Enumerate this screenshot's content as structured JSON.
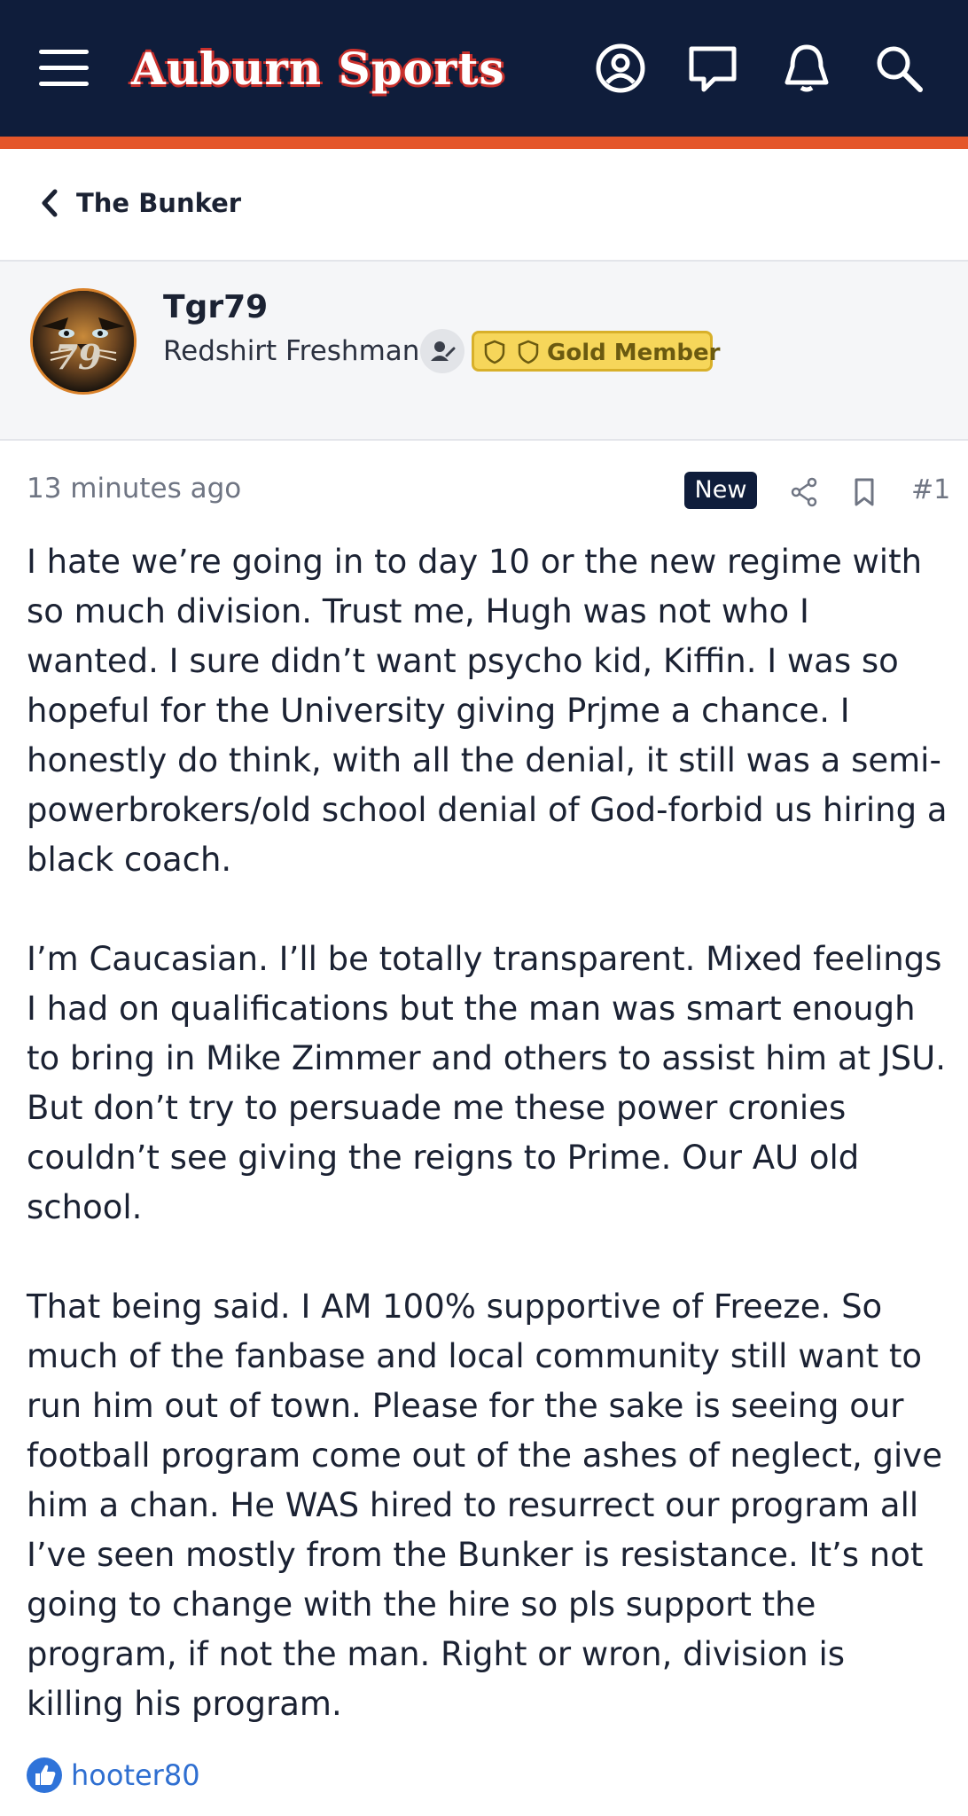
{
  "header": {
    "site_name": "Auburn Sports",
    "brand_navy": "#0f1d3b",
    "brand_orange": "#e4562a",
    "icons": [
      "menu-icon",
      "account-icon",
      "conversations-icon",
      "alerts-icon",
      "search-icon"
    ]
  },
  "breadcrumb": {
    "label": "The Bunker"
  },
  "author": {
    "username": "Tgr79",
    "title": "Redshirt Freshman",
    "badge": "Gold Member",
    "avatar_text": "79"
  },
  "post": {
    "timestamp": "13 minutes ago",
    "new_label": "New",
    "number": "#1",
    "paragraphs": [
      "I hate we’re going in to day 10 or the new regime with so much division. Trust me, Hugh was not who I wanted. I sure didn’t want psycho kid, Kiffin. I was so hopeful for the University giving Prjme a chance. I honestly do think, with all the denial, it still was a semi-powerbrokers/old school denial of God-forbid us hiring a black coach.",
      "I’m Caucasian. I’ll be totally transparent. Mixed feelings I had on qualifications but the man was smart enough to bring in Mike Zimmer and others to assist him at JSU. But don’t try to persuade me these power cronies couldn’t see giving the reigns to Prime. Our AU old school.",
      "That being said. I AM 100% supportive of Freeze. So much of the fanbase and local community still want to run him out of town. Please for the sake is seeing our football program come out of the ashes of neglect, give him a chan. He WAS hired to resurrect our program all I’ve seen mostly from the Bunker is resistance. It’s not going to change with the hire so pls support the program, if not the man. Right or wron, division is killing his program."
    ]
  },
  "reactions": {
    "users": "hooter80",
    "like_color": "#2f73d9"
  }
}
